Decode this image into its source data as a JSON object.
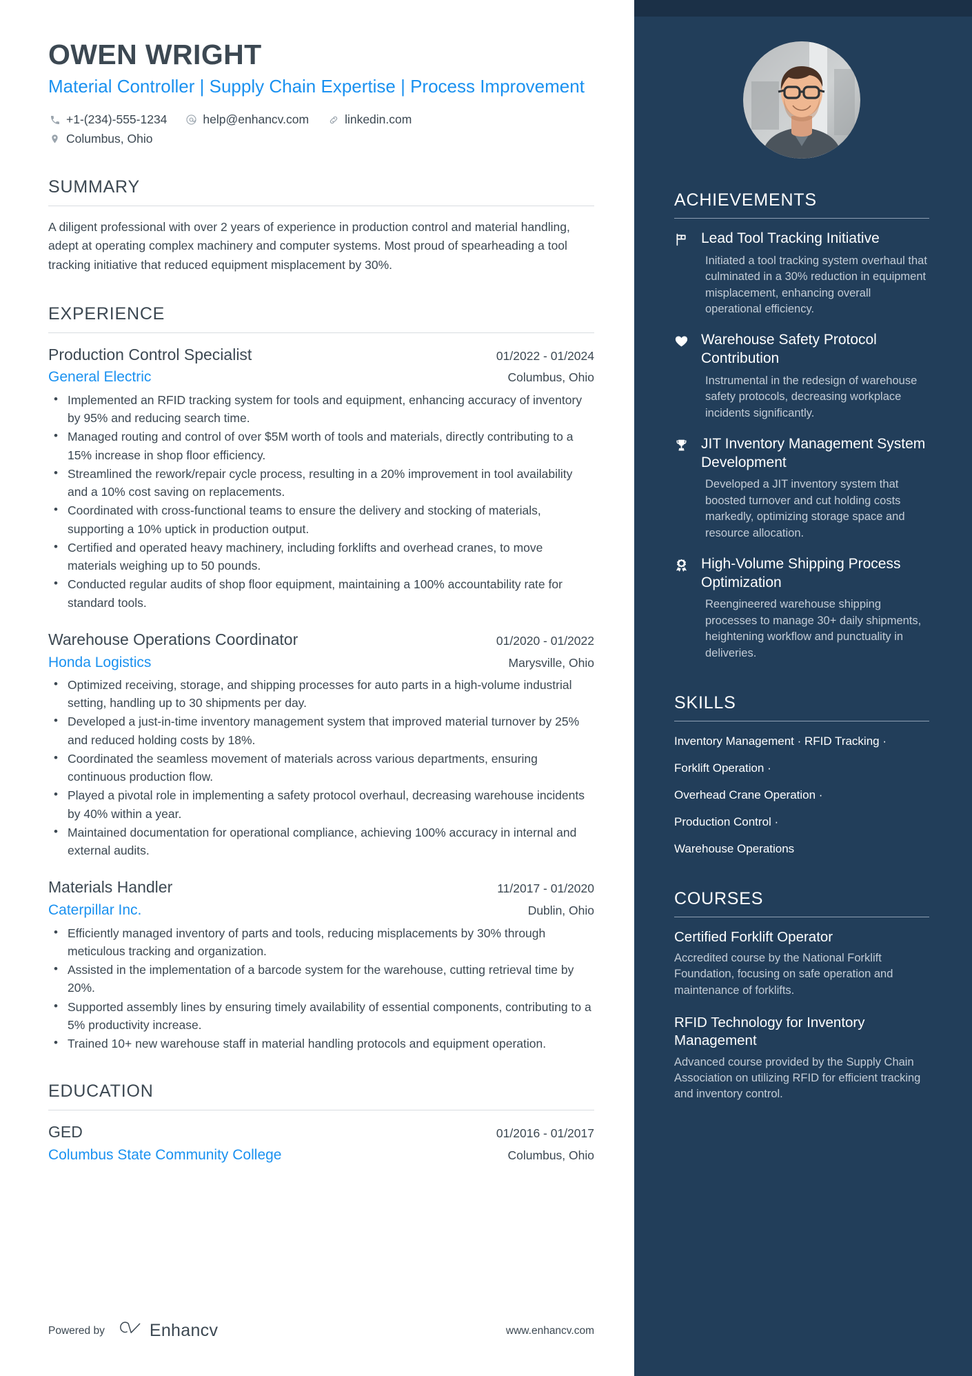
{
  "header": {
    "name": "OWEN WRIGHT",
    "headline": "Material Controller | Supply Chain Expertise | Process Improvement",
    "contacts": [
      {
        "icon": "phone-icon",
        "text": "+1-(234)-555-1234"
      },
      {
        "icon": "email-icon",
        "text": "help@enhancv.com"
      },
      {
        "icon": "link-icon",
        "text": "linkedin.com"
      }
    ],
    "location": {
      "icon": "location-pin-icon",
      "text": "Columbus, Ohio"
    }
  },
  "summary": {
    "title": "SUMMARY",
    "text": "A diligent professional with over 2 years of experience in production control and material handling, adept at operating complex machinery and computer systems. Most proud of spearheading a tool tracking initiative that reduced equipment misplacement by 30%."
  },
  "experience": {
    "title": "EXPERIENCE",
    "entries": [
      {
        "role": "Production Control Specialist",
        "dates": "01/2022 - 01/2024",
        "company": "General Electric",
        "location": "Columbus, Ohio",
        "bullets": [
          "Implemented an RFID tracking system for tools and equipment, enhancing accuracy of inventory by 95% and reducing search time.",
          "Managed routing and control of over $5M worth of tools and materials, directly contributing to a 15% increase in shop floor efficiency.",
          "Streamlined the rework/repair cycle process, resulting in a 20% improvement in tool availability and a 10% cost saving on replacements.",
          "Coordinated with cross-functional teams to ensure the delivery and stocking of materials, supporting a 10% uptick in production output.",
          "Certified and operated heavy machinery, including forklifts and overhead cranes, to move materials weighing up to 50 pounds.",
          "Conducted regular audits of shop floor equipment, maintaining a 100% accountability rate for standard tools."
        ]
      },
      {
        "role": "Warehouse Operations Coordinator",
        "dates": "01/2020 - 01/2022",
        "company": "Honda Logistics",
        "location": "Marysville, Ohio",
        "bullets": [
          "Optimized receiving, storage, and shipping processes for auto parts in a high-volume industrial setting, handling up to 30 shipments per day.",
          "Developed a just-in-time inventory management system that improved material turnover by 25% and reduced holding costs by 18%.",
          "Coordinated the seamless movement of materials across various departments, ensuring continuous production flow.",
          "Played a pivotal role in implementing a safety protocol overhaul, decreasing warehouse incidents by 40% within a year.",
          "Maintained documentation for operational compliance, achieving 100% accuracy in internal and external audits."
        ]
      },
      {
        "role": "Materials Handler",
        "dates": "11/2017 - 01/2020",
        "company": "Caterpillar Inc.",
        "location": "Dublin, Ohio",
        "bullets": [
          "Efficiently managed inventory of parts and tools, reducing misplacements by 30% through meticulous tracking and organization.",
          "Assisted in the implementation of a barcode system for the warehouse, cutting retrieval time by 20%.",
          "Supported assembly lines by ensuring timely availability of essential components, contributing to a 5% productivity increase.",
          "Trained 10+ new warehouse staff in material handling protocols and equipment operation."
        ]
      }
    ]
  },
  "education": {
    "title": "EDUCATION",
    "entries": [
      {
        "degree": "GED",
        "dates": "01/2016 - 01/2017",
        "school": "Columbus State Community College",
        "location": "Columbus, Ohio"
      }
    ]
  },
  "achievements": {
    "title": "ACHIEVEMENTS",
    "items": [
      {
        "icon": "flag-icon",
        "title": "Lead Tool Tracking Initiative",
        "description": "Initiated a tool tracking system overhaul that culminated in a 30% reduction in equipment misplacement, enhancing overall operational efficiency."
      },
      {
        "icon": "heart-icon",
        "title": "Warehouse Safety Protocol Contribution",
        "description": "Instrumental in the redesign of warehouse safety protocols, decreasing workplace incidents significantly."
      },
      {
        "icon": "trophy-icon",
        "title": "JIT Inventory Management System Development",
        "description": "Developed a JIT inventory system that boosted turnover and cut holding costs markedly, optimizing storage space and resource allocation."
      },
      {
        "icon": "award-ribbon-icon",
        "title": "High-Volume Shipping Process Optimization",
        "description": "Reengineered warehouse shipping processes to manage 30+ daily shipments, heightening workflow and punctuality in deliveries."
      }
    ]
  },
  "skills": {
    "title": "SKILLS",
    "lines": [
      "Inventory Management · RFID Tracking ·",
      "Forklift Operation ·",
      "Overhead Crane Operation ·",
      "Production Control ·",
      "Warehouse Operations"
    ]
  },
  "courses": {
    "title": "COURSES",
    "items": [
      {
        "title": "Certified Forklift Operator",
        "description": "Accredited course by the National Forklift Foundation, focusing on safe operation and maintenance of forklifts."
      },
      {
        "title": "RFID Technology for Inventory Management",
        "description": "Advanced course provided by the Supply Chain Association on utilizing RFID for efficient tracking and inventory control."
      }
    ]
  },
  "footer": {
    "powered_by": "Powered by",
    "brand": "Enhancv",
    "website": "www.enhancv.com"
  },
  "colors": {
    "sidebar_bg": "#223E5A",
    "sidebar_topbar": "#1b3047",
    "accent_blue": "#1a91f0",
    "body_text": "#3c4852"
  }
}
